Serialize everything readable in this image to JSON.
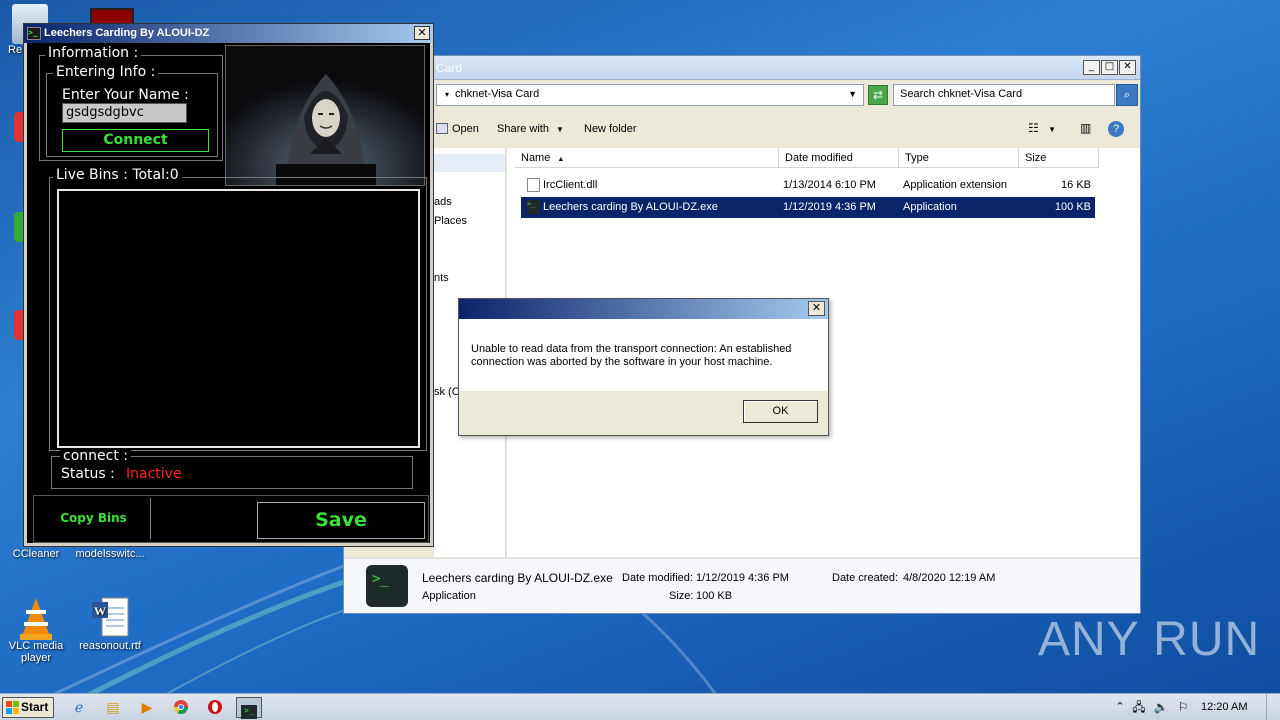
{
  "desktop": {
    "icons": [
      {
        "label": "CCleaner"
      },
      {
        "label": "modelsswitc..."
      },
      {
        "label": "VLC media player"
      },
      {
        "label": "reasonout.rtf"
      }
    ],
    "partial_label_top": "Re",
    "watermark": "ANY  RUN"
  },
  "explorer": {
    "title": "Card",
    "address": "chknet-Visa Card",
    "search_placeholder": "Search chknet-Visa Card",
    "toolbar": {
      "open": "Open",
      "share_with": "Share with",
      "new_folder": "New folder"
    },
    "nav_items": [
      "ads",
      "Places",
      "nts",
      "sk (C"
    ],
    "columns": {
      "name": "Name",
      "date": "Date modified",
      "type": "Type",
      "size": "Size"
    },
    "files": [
      {
        "name": "IrcClient.dll",
        "date": "1/13/2014 6:10 PM",
        "type": "Application extension",
        "size": "16 KB"
      },
      {
        "name": "Leechers  carding By ALOUI-DZ.exe",
        "date": "1/12/2019 4:36 PM",
        "type": "Application",
        "size": "100 KB"
      }
    ],
    "details": {
      "name": "Leechers  carding By ALOUI-DZ.exe",
      "date_modified_label": "Date modified:",
      "date_modified": "1/12/2019 4:36 PM",
      "date_created_label": "Date created:",
      "date_created": "4/8/2020 12:19 AM",
      "type": "Application",
      "size_label": "Size:",
      "size": "100 KB"
    }
  },
  "dialog": {
    "message": "Unable to read data from the transport connection: An established connection was aborted by the software in your host machine.",
    "ok": "OK"
  },
  "app": {
    "title": "Leechers Carding By ALOUI-DZ",
    "information": "Information :",
    "entering_info": "Entering Info :",
    "enter_name": "Enter Your Name :",
    "name_value": "gsdgsdgbvc",
    "connect": "Connect",
    "live_bins": "Live Bins : Total:0",
    "connect_label": "connect :",
    "status_label": "Status :",
    "status_value": "Inactive",
    "copy_bins": "Copy Bins",
    "save": "Save",
    "accent": "#3ae03a",
    "status_color": "#ff2222"
  },
  "taskbar": {
    "start": "Start",
    "clock": "12:20 AM"
  }
}
